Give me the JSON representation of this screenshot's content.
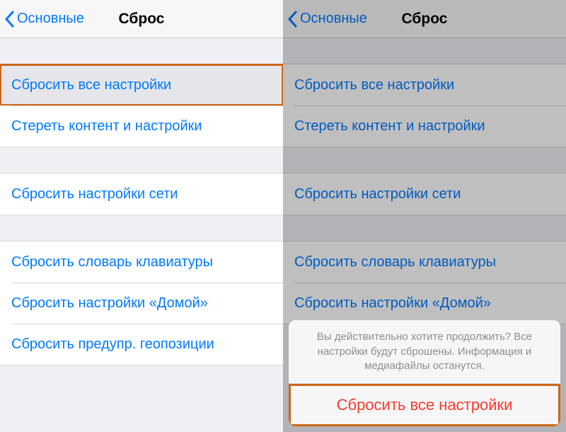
{
  "left": {
    "nav": {
      "back": "Основные",
      "title": "Сброс"
    },
    "group1": [
      {
        "label": "Сбросить все настройки"
      },
      {
        "label": "Стереть контент и настройки"
      }
    ],
    "group2": [
      {
        "label": "Сбросить настройки сети"
      }
    ],
    "group3": [
      {
        "label": "Сбросить словарь клавиатуры"
      },
      {
        "label": "Сбросить настройки «Домой»"
      },
      {
        "label": "Сбросить предупр. геопозиции"
      }
    ]
  },
  "right": {
    "nav": {
      "back": "Основные",
      "title": "Сброс"
    },
    "group1": [
      {
        "label": "Сбросить все настройки"
      },
      {
        "label": "Стереть контент и настройки"
      }
    ],
    "group2": [
      {
        "label": "Сбросить настройки сети"
      }
    ],
    "group3": [
      {
        "label": "Сбросить словарь клавиатуры"
      },
      {
        "label": "Сбросить настройки «Домой»"
      }
    ],
    "sheet": {
      "message": "Вы действительно хотите продолжить? Все настройки будут сброшены. Информация и медиафайлы останутся.",
      "destructive": "Сбросить все настройки"
    }
  }
}
